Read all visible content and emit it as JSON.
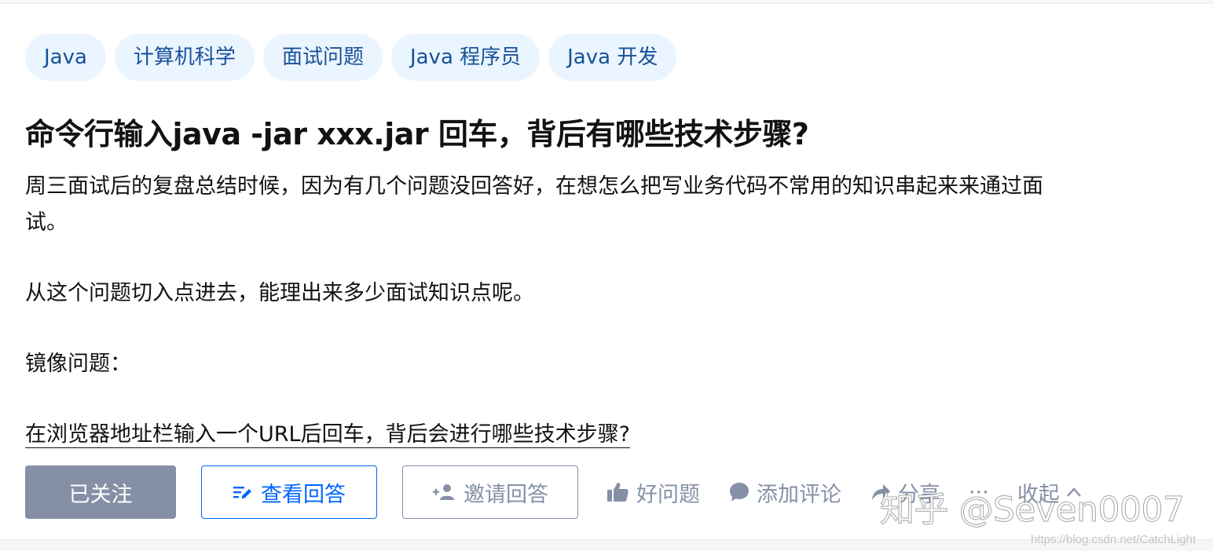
{
  "topics": [
    "Java",
    "计算机科学",
    "面试问题",
    "Java 程序员",
    "Java 开发"
  ],
  "question": {
    "title": "命令行输入java -jar xxx.jar 回车，背后有哪些技术步骤?",
    "detail": {
      "para1": "周三面试后的复盘总结时候，因为有几个问题没回答好，在想怎么把写业务代码不常用的知识串起来来通过面试。",
      "para2": "从这个问题切入点进去，能理出来多少面试知识点呢。",
      "para3": "镜像问题：",
      "mirror_link": "在浏览器地址栏输入一个URL后回车，背后会进行哪些技术步骤?"
    }
  },
  "actions": {
    "follow": "已关注",
    "view_answers": "查看回答",
    "invite": "邀请回答",
    "good_question": "好问题",
    "add_comment": "添加评论",
    "share": "分享",
    "more": "···",
    "collapse": "收起"
  },
  "icons": {
    "view": "edit-list-icon",
    "invite": "add-user-icon",
    "good": "thumb-up-icon",
    "comment": "comment-bubble-icon",
    "share": "share-icon",
    "collapse": "chevron-up-icon"
  },
  "watermark": "知乎 @Seven0007",
  "url_watermark": "https://blog.csdn.net/CatchLight",
  "colors": {
    "tag_bg": "#ebf5ff",
    "tag_text": "#175199",
    "primary": "#0066ff",
    "muted": "#8590a6"
  }
}
